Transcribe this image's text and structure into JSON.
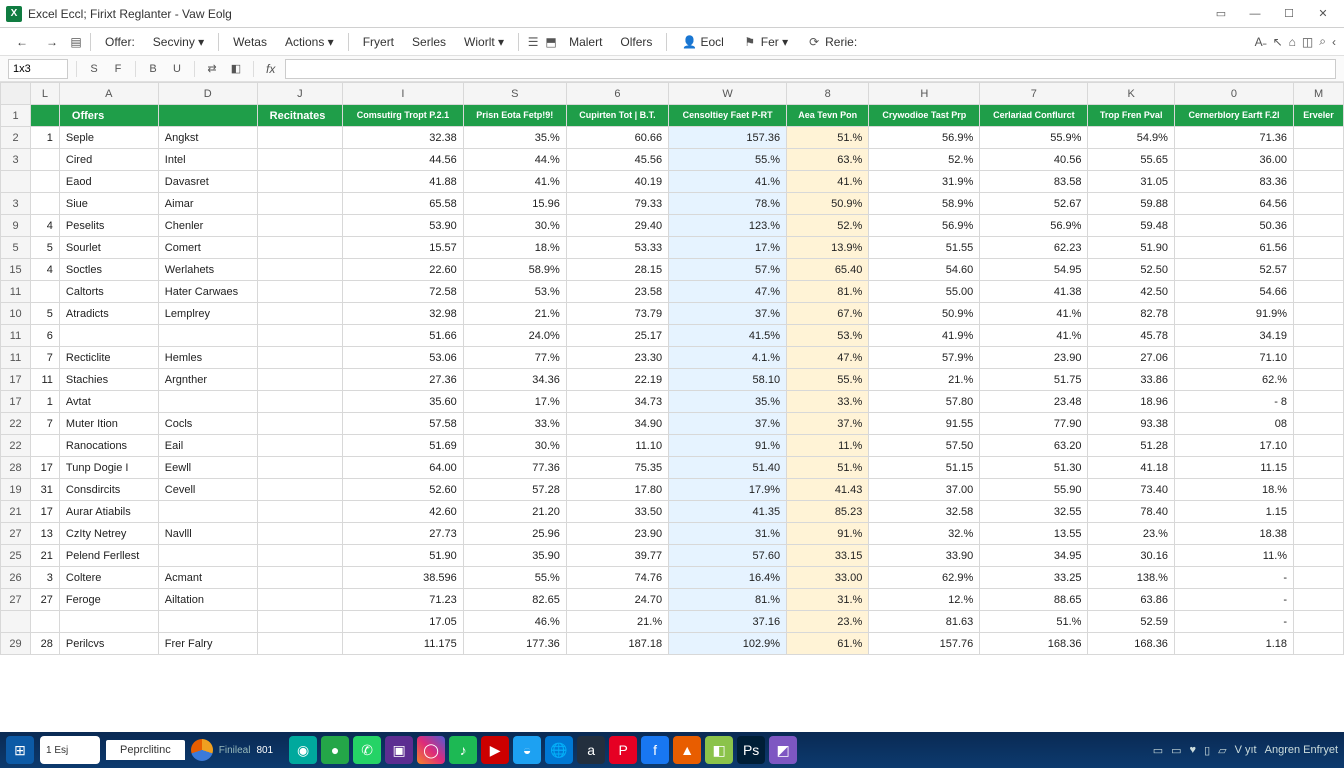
{
  "title": "Excel  Eccl;  Firixt Reglanter - Vaw  Eolg",
  "app_icon_letter": "X",
  "window_controls": {
    "box": "▭",
    "min": "—",
    "max": "☐",
    "close": "✕"
  },
  "menu": {
    "back": "←",
    "fwd": "→",
    "items": [
      "Offer:",
      "Secviny ▾",
      "Wetas",
      "Actions ▾",
      "Fryert",
      "Serles",
      "Wiorlt ▾"
    ],
    "icons": [
      "☰",
      "⬒"
    ],
    "right_items": [
      "Malert",
      "Olfers"
    ],
    "right_icons": [
      {
        "name": "user-icon",
        "label": "Eocl"
      },
      {
        "name": "flag-icon",
        "label": "Fer ▾"
      },
      {
        "name": "refresh-icon",
        "label": "Rerie:"
      }
    ],
    "far_right": [
      "A˗",
      "↖",
      "⌂",
      "◫",
      "⌕",
      "‹"
    ]
  },
  "toolbar2": {
    "namebox": "1x3",
    "icons": [
      "S",
      "F",
      "B",
      "U",
      "⇄",
      "◧"
    ],
    "fx": "fx",
    "formula": ""
  },
  "columns": [
    "L",
    "A",
    "D",
    "J",
    "I",
    "S",
    "6",
    "W",
    "8",
    "H",
    "7",
    "K",
    "0",
    "M"
  ],
  "header_row": {
    "a": "",
    "b": "Offers",
    "c": "",
    "d": "Recitnates",
    "e": "Comsutirg Tropt P.2.1",
    "f": "Prisn Eota Fetp!9!",
    "g": "Cupirten Tot | B.T.",
    "h": "Censoltiey Faet P-RT",
    "i": "Aea Tevn Pon",
    "j": "Crywodioe Tast Prp",
    "k": "Cerlariad Conflurct",
    "l": "Trop Fren Pval",
    "m": "Cernerblory Earft F.2l",
    "n": "Erveler"
  },
  "row_numbers": [
    "1",
    "2",
    "3",
    "",
    "3",
    "9",
    "5",
    "15",
    "11",
    "10",
    "11",
    "11",
    "17",
    "17",
    "22",
    "22",
    "28",
    "19",
    "21",
    "27",
    "25",
    "26",
    "27",
    "",
    "29"
  ],
  "rows": [
    {
      "idx": "1",
      "a": "Seple",
      "b": "Angkst",
      "c": "",
      "v": [
        "32.38",
        "35.%",
        "60.66",
        "157.36",
        "51.%",
        "56.9%",
        "55.9%",
        "54.9%",
        "71.36",
        ""
      ]
    },
    {
      "idx": "",
      "a": "Cired",
      "b": "Intel",
      "c": "",
      "v": [
        "44.56",
        "44.%",
        "45.56",
        "55.%",
        "63.%",
        "52.%",
        "40.56",
        "55.65",
        "36.00",
        ""
      ]
    },
    {
      "idx": "",
      "a": "Eaod",
      "b": "Davasret",
      "c": "",
      "v": [
        "41.88",
        "41.%",
        "40.19",
        "41.%",
        "41.%",
        "31.9%",
        "83.58",
        "31.05",
        "83.36",
        ""
      ]
    },
    {
      "idx": "",
      "a": "Siue",
      "b": "Aimar",
      "c": "",
      "v": [
        "65.58",
        "15.96",
        "79.33",
        "78.%",
        "50.9%",
        "58.9%",
        "52.67",
        "59.88",
        "64.56",
        ""
      ]
    },
    {
      "idx": "4",
      "a": "Peselits",
      "b": "Chenler",
      "c": "",
      "v": [
        "53.90",
        "30.%",
        "29.40",
        "123.%",
        "52.%",
        "56.9%",
        "56.9%",
        "59.48",
        "50.36",
        ""
      ]
    },
    {
      "idx": "5",
      "a": "Sourlet",
      "b": "Comert",
      "c": "",
      "v": [
        "15.57",
        "18.%",
        "53.33",
        "17.%",
        "13.9%",
        "51.55",
        "62.23",
        "51.90",
        "61.56",
        ""
      ]
    },
    {
      "idx": "4",
      "a": "Soctles",
      "b": "Werlahets",
      "c": "",
      "v": [
        "22.60",
        "58.9%",
        "28.15",
        "57.%",
        "65.40",
        "54.60",
        "54.95",
        "52.50",
        "52.57",
        ""
      ]
    },
    {
      "idx": "",
      "a": "Caltorts",
      "b": "Hater Carwaes",
      "c": "",
      "v": [
        "72.58",
        "53.%",
        "23.58",
        "47.%",
        "81.%",
        "55.00",
        "41.38",
        "42.50",
        "54.66",
        ""
      ]
    },
    {
      "idx": "5",
      "a": "Atradicts",
      "b": "Lemplrey",
      "c": "",
      "v": [
        "32.98",
        "21.%",
        "73.79",
        "37.%",
        "67.%",
        "50.9%",
        "41.%",
        "82.78",
        "91.9%",
        ""
      ]
    },
    {
      "idx": "6",
      "a": "",
      "b": "",
      "c": "",
      "v": [
        "51.66",
        "24.0%",
        "25.17",
        "41.5%",
        "53.%",
        "41.9%",
        "41.%",
        "45.78",
        "34.19",
        ""
      ]
    },
    {
      "idx": "7",
      "a": "Recticlite",
      "b": "Hemles",
      "c": "",
      "v": [
        "53.06",
        "77.%",
        "23.30",
        "4.1.%",
        "47.%",
        "57.9%",
        "23.90",
        "27.06",
        "71.10",
        ""
      ]
    },
    {
      "idx": "11",
      "a": "Stachies",
      "b": "Argnther",
      "c": "",
      "v": [
        "27.36",
        "34.36",
        "22.19",
        "58.10",
        "55.%",
        "21.%",
        "51.75",
        "33.86",
        "62.%",
        ""
      ]
    },
    {
      "idx": "1",
      "a": "Avtat",
      "b": "",
      "c": "",
      "v": [
        "35.60",
        "17.%",
        "34.73",
        "35.%",
        "33.%",
        "57.80",
        "23.48",
        "18.96",
        "- 8",
        ""
      ]
    },
    {
      "idx": "7",
      "a": "Muter Ition",
      "b": "Cocls",
      "c": "",
      "v": [
        "57.58",
        "33.%",
        "34.90",
        "37.%",
        "37.%",
        "91.55",
        "77.90",
        "93.38",
        "08",
        ""
      ]
    },
    {
      "idx": "",
      "a": "Ranocations",
      "b": "Eail",
      "c": "",
      "v": [
        "51.69",
        "30.%",
        "11.10",
        "91.%",
        "11.%",
        "57.50",
        "63.20",
        "51.28",
        "17.10",
        ""
      ]
    },
    {
      "idx": "17",
      "a": "Tunp Dogie I",
      "b": "Eewll",
      "c": "",
      "v": [
        "64.00",
        "77.36",
        "75.35",
        "51.40",
        "51.%",
        "51.15",
        "51.30",
        "41.18",
        "11.15",
        ""
      ]
    },
    {
      "idx": "31",
      "a": "Consdircits",
      "b": "Cevell",
      "c": "",
      "v": [
        "52.60",
        "57.28",
        "17.80",
        "17.9%",
        "41.43",
        "37.00",
        "55.90",
        "73.40",
        "18.%",
        ""
      ]
    },
    {
      "idx": "17",
      "a": "Aurar Atiabils",
      "b": "",
      "c": "",
      "v": [
        "42.60",
        "21.20",
        "33.50",
        "41.35",
        "85.23",
        "32.58",
        "32.55",
        "78.40",
        "1.15",
        ""
      ]
    },
    {
      "idx": "13",
      "a": "CzIty Netrey",
      "b": "Navlll",
      "c": "",
      "v": [
        "27.73",
        "25.96",
        "23.90",
        "31.%",
        "91.%",
        "32.%",
        "13.55",
        "23.%",
        "18.38",
        ""
      ]
    },
    {
      "idx": "21",
      "a": "Pelend Ferllest",
      "b": "",
      "c": "",
      "v": [
        "51.90",
        "35.90",
        "39.77",
        "57.60",
        "33.15",
        "33.90",
        "34.95",
        "30.16",
        "11.%",
        ""
      ]
    },
    {
      "idx": "3",
      "a": "Coltere",
      "b": "Acmant",
      "c": "",
      "v": [
        "38.596",
        "55.%",
        "74.76",
        "16.4%",
        "33.00",
        "62.9%",
        "33.25",
        "138.%",
        "-",
        ""
      ]
    },
    {
      "idx": "27",
      "a": "Feroge",
      "b": "Ailtation",
      "c": "",
      "v": [
        "71.23",
        "82.65",
        "24.70",
        "81.%",
        "31.%",
        "12.%",
        "88.65",
        "63.86",
        "-",
        ""
      ]
    },
    {
      "idx": "",
      "a": "",
      "b": "",
      "c": "",
      "v": [
        "17.05",
        "46.%",
        "21.%",
        "37.16",
        "23.%",
        "81.63",
        "51.%",
        "52.59",
        "-",
        ""
      ]
    },
    {
      "idx": "28",
      "a": "Perilcvs",
      "b": "Frer Falry",
      "c": "",
      "v": [
        "11.175",
        "177.36",
        "187.18",
        "102.9%",
        "61.%",
        "157.76",
        "168.36",
        "168.36",
        "1.18",
        ""
      ]
    }
  ],
  "sheet_tabs": {
    "active": "Peprclitinc",
    "totals_label": "Finileal",
    "totals_val": "801"
  },
  "taskbar": {
    "start": "⊞",
    "search": "1 Esj",
    "right": [
      "▭",
      "▭",
      "♥",
      "▯",
      "▱"
    ],
    "clock": "V   yıt",
    "right_label": "Angren Enfryet"
  }
}
